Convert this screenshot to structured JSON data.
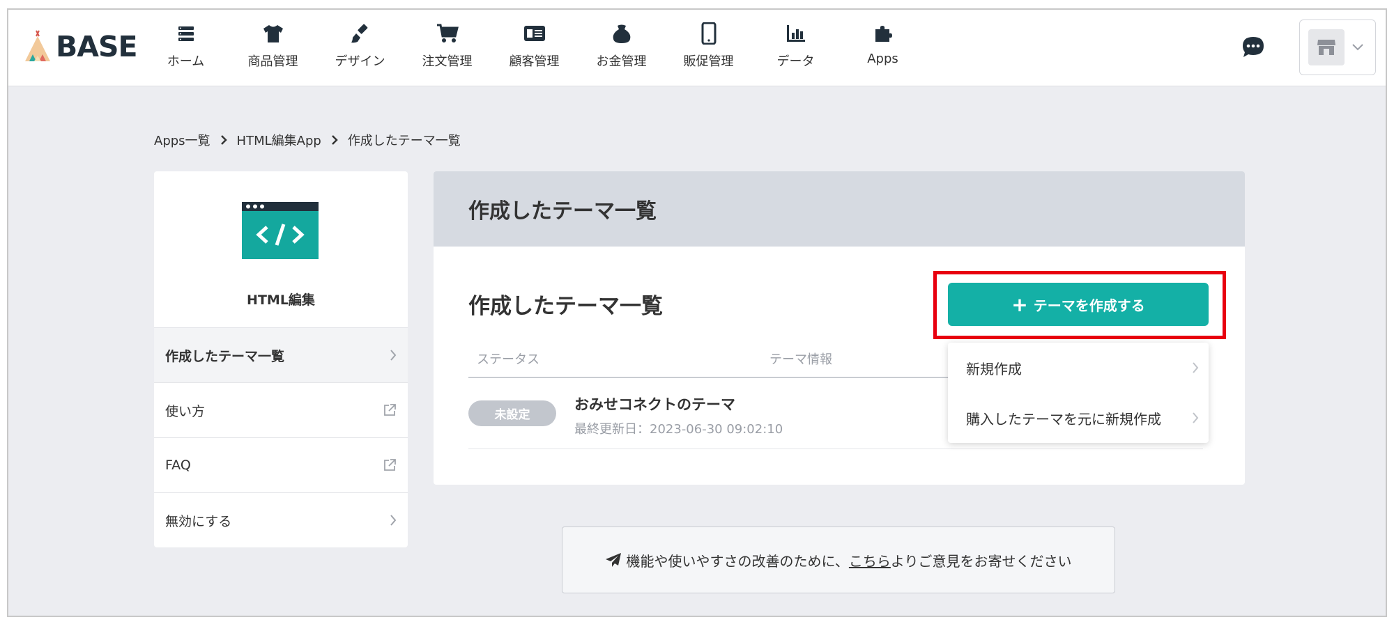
{
  "brand": {
    "name": "BASE",
    "accent": "#14b0a6",
    "highlight": "#e8000f"
  },
  "nav": [
    {
      "label": "ホーム",
      "icon": "home-list-icon"
    },
    {
      "label": "商品管理",
      "icon": "tshirt-icon"
    },
    {
      "label": "デザイン",
      "icon": "brush-icon"
    },
    {
      "label": "注文管理",
      "icon": "cart-icon"
    },
    {
      "label": "顧客管理",
      "icon": "id-card-icon"
    },
    {
      "label": "お金管理",
      "icon": "wallet-icon"
    },
    {
      "label": "販促管理",
      "icon": "smartphone-icon"
    },
    {
      "label": "データ",
      "icon": "bar-chart-icon"
    },
    {
      "label": "Apps",
      "icon": "puzzle-icon"
    }
  ],
  "breadcrumb": [
    "Apps一覧",
    "HTML編集App",
    "作成したテーマ一覧"
  ],
  "sidebar": {
    "app_name": "HTML編集",
    "items": [
      {
        "label": "作成したテーマ一覧",
        "icon": "chevron-right-icon"
      },
      {
        "label": "使い方",
        "icon": "external-link-icon"
      },
      {
        "label": "FAQ",
        "icon": "external-link-icon"
      },
      {
        "label": "無効にする",
        "icon": "chevron-right-icon"
      }
    ]
  },
  "main": {
    "header_title": "作成したテーマ一覧",
    "section_title": "作成したテーマ一覧",
    "create_button": "テーマを作成する",
    "columns": {
      "status": "ステータス",
      "theme_info": "テーマ情報"
    },
    "rows": [
      {
        "status": "未設定",
        "name": "おみせコネクトのテーマ",
        "updated": "最終更新日：2023-06-30 09:02:10"
      }
    ]
  },
  "dropdown": {
    "items": [
      "新規作成",
      "購入したテーマを元に新規作成"
    ]
  },
  "feedback": {
    "before": "機能や使いやすさの改善のために、",
    "link": "こちら",
    "after": "よりご意見をお寄せください"
  }
}
